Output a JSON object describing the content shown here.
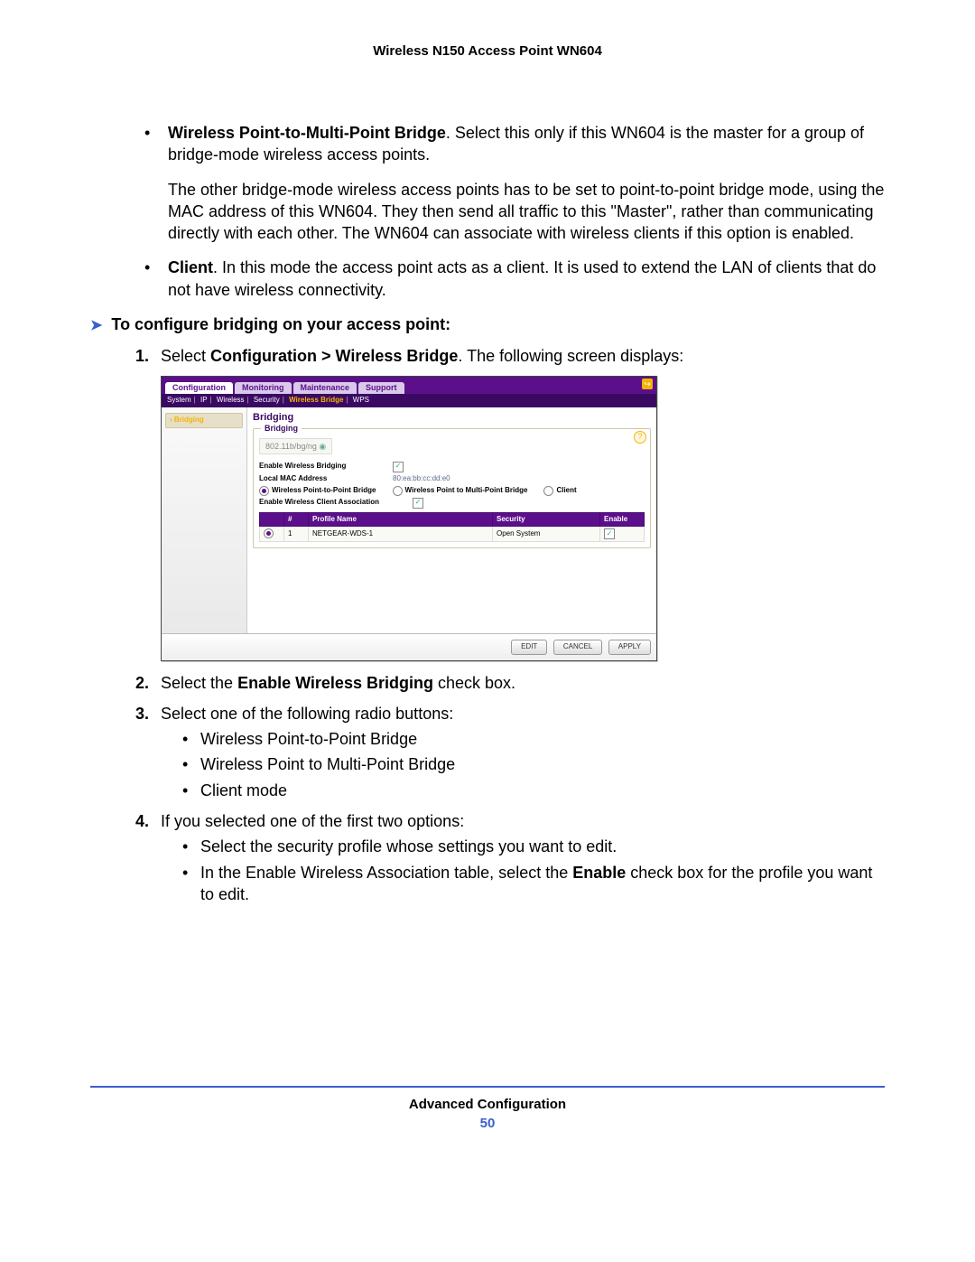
{
  "header": {
    "title": "Wireless N150 Access Point WN604"
  },
  "intro_bullets": {
    "b1_bold": "Wireless Point-to-Multi-Point Bridge",
    "b1_text": ". Select this only if this WN604 is the master for a group of bridge-mode wireless access points.",
    "b1_para2": "The other bridge-mode wireless access points has to be set to point-to-point bridge mode, using the MAC address of this WN604. They then send all traffic to this \"Master\", rather than communicating directly with each other. The WN604 can associate with wireless clients if this option is enabled.",
    "b2_bold": "Client",
    "b2_text": ". In this mode the access point acts as a client. It is used to extend the LAN of clients that do not have wireless connectivity."
  },
  "section": {
    "arrow": "➤",
    "title": "To configure bridging on your access point:"
  },
  "steps": {
    "s1_pre": "Select ",
    "s1_bold": "Configuration > Wireless Bridge",
    "s1_post": ". The following screen displays:",
    "s2_pre": "Select the ",
    "s2_bold": "Enable Wireless Bridging",
    "s2_post": " check box.",
    "s3": "Select one of the following radio buttons:",
    "s3_items": [
      "Wireless Point-to-Point Bridge",
      "Wireless Point to Multi-Point Bridge",
      "Client mode"
    ],
    "s4": "If you selected one of the first two options:",
    "s4_a": "Select the security profile whose settings you want to edit.",
    "s4_b_pre": "In the Enable Wireless Association table, select the ",
    "s4_b_bold": "Enable",
    "s4_b_post": " check box for the profile you want to edit."
  },
  "screenshot": {
    "tabs": [
      "Configuration",
      "Monitoring",
      "Maintenance",
      "Support"
    ],
    "subnav": {
      "items": [
        "System",
        "IP",
        "Wireless",
        "Security"
      ],
      "active": "Wireless Bridge",
      "tail": "WPS"
    },
    "left_item": "Bridging",
    "title": "Bridging",
    "panel_title": "Bridging",
    "band": "802.11b/bg/ng",
    "enable_label": "Enable Wireless Bridging",
    "mac_label": "Local MAC Address",
    "mac_value": "80:ea:bb:cc:dd:e0",
    "radio1": "Wireless Point-to-Point Bridge",
    "radio2": "Wireless Point to Multi-Point Bridge",
    "radio3": "Client",
    "assoc_label": "Enable Wireless Client Association",
    "th_hash": "#",
    "th_profile": "Profile Name",
    "th_security": "Security",
    "th_enable": "Enable",
    "row_num": "1",
    "row_profile": "NETGEAR-WDS-1",
    "row_security": "Open System",
    "btn_edit": "EDIT",
    "btn_cancel": "CANCEL",
    "btn_apply": "APPLY",
    "help": "?"
  },
  "footer": {
    "section": "Advanced Configuration",
    "page": "50"
  }
}
